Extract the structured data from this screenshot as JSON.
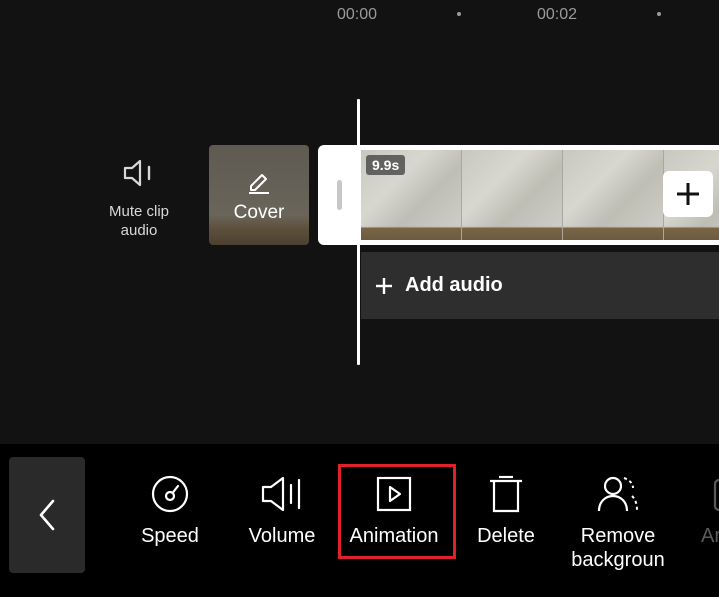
{
  "ruler": {
    "times": [
      "00:00",
      "00:02"
    ]
  },
  "track": {
    "mute_label": "Mute clip audio",
    "cover_label": "Cover",
    "clip_duration": "9.9s",
    "add_audio_label": "Add audio"
  },
  "toolbar": {
    "tools": [
      {
        "label": "Speed",
        "icon": "speed-icon"
      },
      {
        "label": "Volume",
        "icon": "volume-icon"
      },
      {
        "label": "Animation",
        "icon": "animation-icon",
        "highlighted": true
      },
      {
        "label": "Delete",
        "icon": "delete-icon"
      },
      {
        "label": "Remove backgroun",
        "icon": "remove-background-icon"
      },
      {
        "label": "Ar",
        "icon": "adjust-icon"
      }
    ]
  },
  "colors": {
    "background": "#121212",
    "toolbar": "#000000",
    "highlight": "#e0202b",
    "audio_track": "#2e2e2e"
  }
}
